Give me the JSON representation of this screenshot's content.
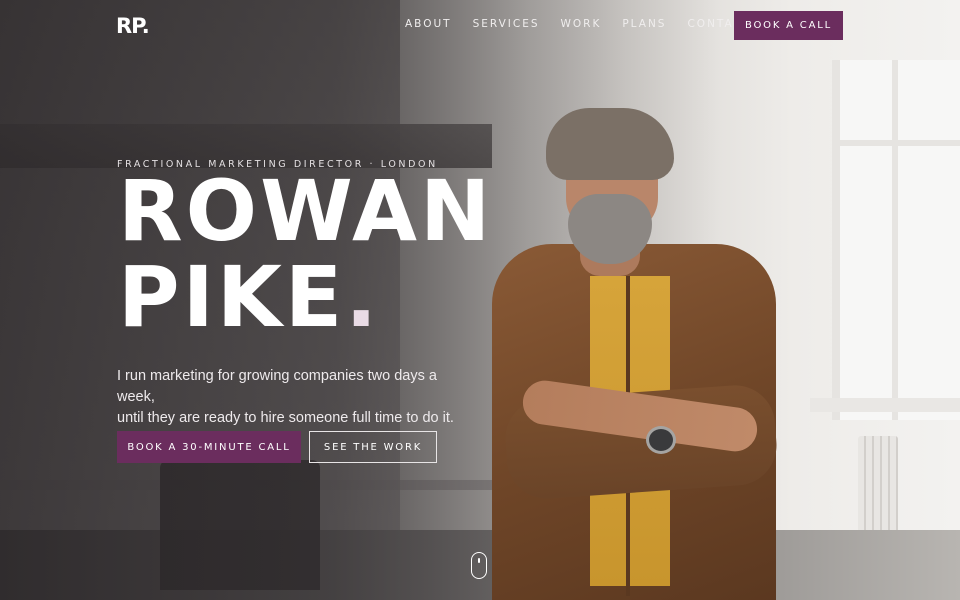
{
  "brand": {
    "logo_text": "RP.",
    "accent_color": "#6b2d5e"
  },
  "nav": {
    "links": [
      {
        "label": "ABOUT"
      },
      {
        "label": "SERVICES"
      },
      {
        "label": "WORK"
      },
      {
        "label": "PLANS"
      },
      {
        "label": "CONTACT"
      }
    ],
    "cta_label": "BOOK A CALL"
  },
  "hero": {
    "eyebrow": "FRACTIONAL MARKETING DIRECTOR · LONDON",
    "headline_line1": "ROWAN",
    "headline_line2": "PIKE",
    "headline_dot": ".",
    "lede_line1": "I run marketing for growing companies two days a week,",
    "lede_line2": "until they are ready to hire someone full time to do it.",
    "primary_cta": "BOOK A 30-MINUTE CALL",
    "secondary_cta": "SEE THE WORK",
    "scroll_icon": "mouse-scroll-icon"
  }
}
